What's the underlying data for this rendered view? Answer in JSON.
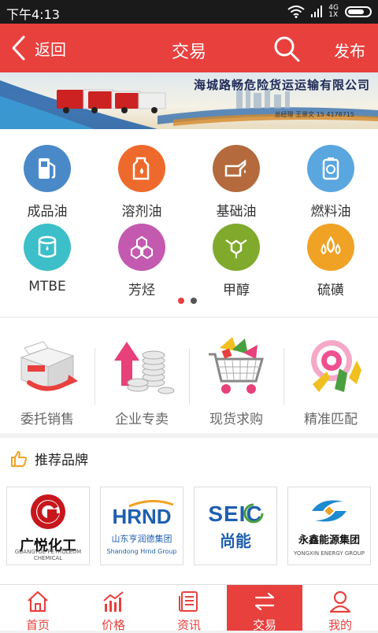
{
  "status_bar": {
    "time": "下午4:13",
    "network_top": "4G",
    "network_bottom": "1X"
  },
  "navbar": {
    "back_label": "返回",
    "title": "交易",
    "publish_label": "发布"
  },
  "banner": {
    "company": "海城路畅危险货运运输有限公司",
    "contact": "总经理  王景文  15   4178715"
  },
  "categories": [
    {
      "label": "成品油",
      "color": "#4a89c8",
      "icon": "gas-pump-icon"
    },
    {
      "label": "溶剂油",
      "color": "#ee6a2c",
      "icon": "solvent-can-icon"
    },
    {
      "label": "基础油",
      "color": "#b46a3c",
      "icon": "oil-can-icon"
    },
    {
      "label": "燃料油",
      "color": "#5aa7e0",
      "icon": "fuel-drum-icon"
    },
    {
      "label": "MTBE",
      "color": "#3cbfc8",
      "icon": "barrel-icon"
    },
    {
      "label": "芳烃",
      "color": "#c45ab0",
      "icon": "hexagon-molecule-icon"
    },
    {
      "label": "甲醇",
      "color": "#80aa2c",
      "icon": "molecule-icon"
    },
    {
      "label": "硫磺",
      "color": "#f0a224",
      "icon": "flame-drops-icon"
    }
  ],
  "services": [
    {
      "label": "委托销售",
      "icon": "delegate-box-icon"
    },
    {
      "label": "企业专卖",
      "icon": "growth-coins-icon"
    },
    {
      "label": "现货求购",
      "icon": "shopping-cart-icon"
    },
    {
      "label": "精准匹配",
      "icon": "target-icon"
    }
  ],
  "brands": {
    "title": "推荐品牌",
    "items": [
      {
        "name": "广悦化工",
        "sub": "GUANGYUE PETROLEUM CHEMICAL"
      },
      {
        "name": "HRND",
        "cn": "山东亨润德集团",
        "sub": "Shandong Hrnd Group"
      },
      {
        "name": "SEIC",
        "cn": "尚能"
      },
      {
        "name": "永鑫能源集团",
        "sub": "YONGXIN ENERGY GROUP"
      }
    ]
  },
  "tabs": [
    {
      "label": "首页",
      "icon": "home-icon"
    },
    {
      "label": "价格",
      "icon": "chart-icon"
    },
    {
      "label": "资讯",
      "icon": "news-icon"
    },
    {
      "label": "交易",
      "icon": "exchange-icon"
    },
    {
      "label": "我的",
      "icon": "user-icon"
    }
  ],
  "active_tab": "交易",
  "colors": {
    "brand_red": "#e8403d",
    "pager_inactive": "#555555"
  }
}
